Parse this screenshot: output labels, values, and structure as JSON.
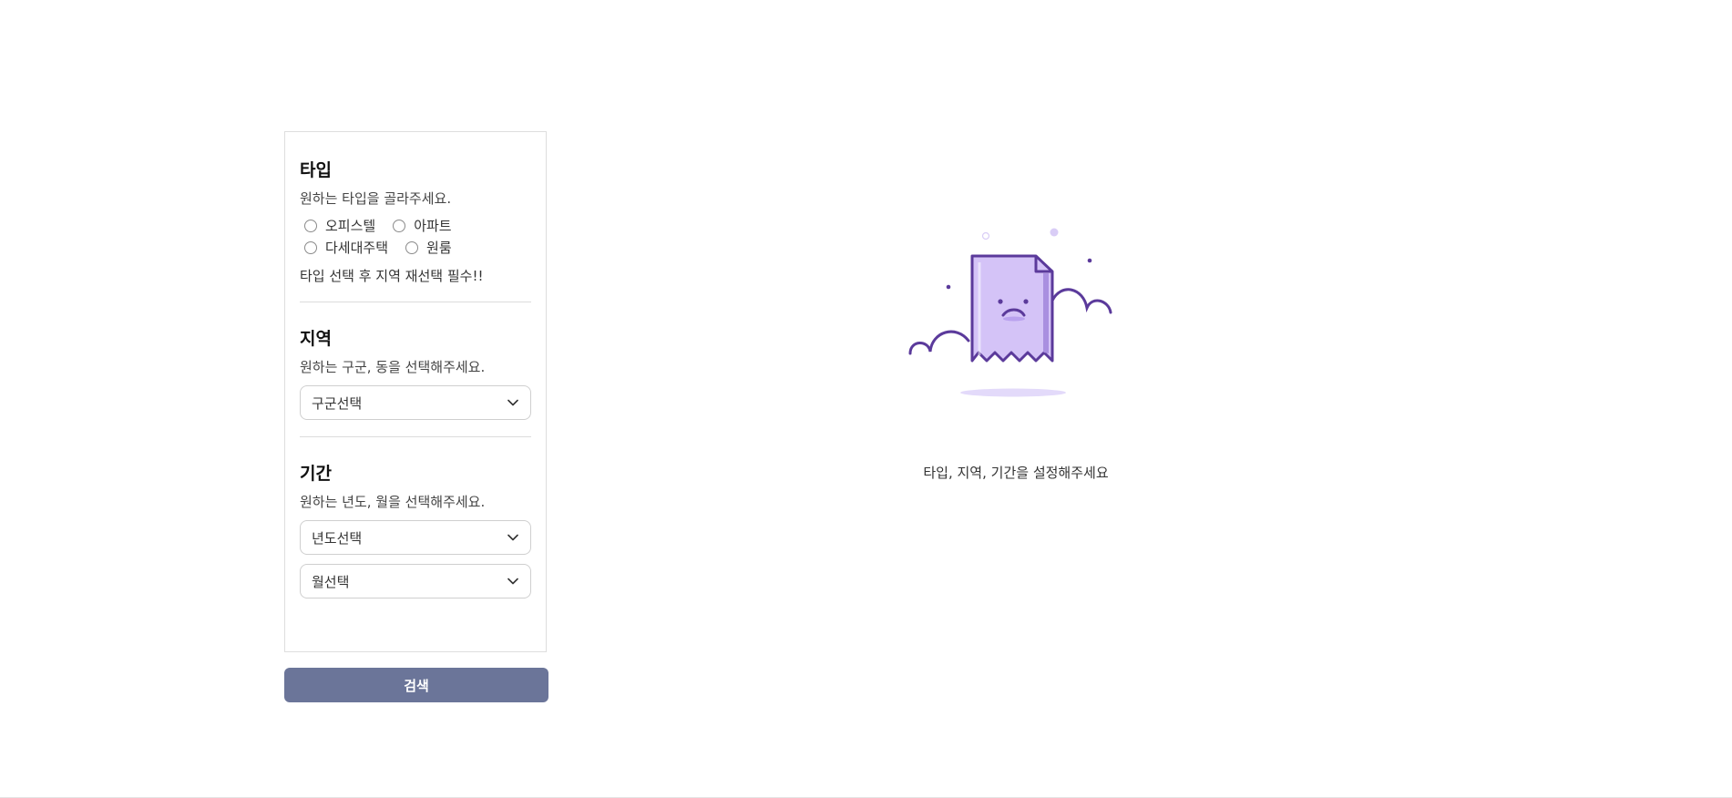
{
  "type_section": {
    "title": "타입",
    "description": "원하는 타입을 골라주세요.",
    "options_row1": [
      "오피스텔",
      "아파트"
    ],
    "options_row2": [
      "다세대주택",
      "원룸"
    ],
    "note": "타입 선택 후 지역 재선택 필수!!"
  },
  "region_section": {
    "title": "지역",
    "description": "원하는 구군, 동을 선택해주세요.",
    "district_select": "구군선택"
  },
  "period_section": {
    "title": "기간",
    "description": "원하는 년도, 월을 선택해주세요.",
    "year_select": "년도선택",
    "month_select": "월선택"
  },
  "search_button_label": "검색",
  "empty_state": {
    "message": "타입, 지역, 기간을 설정해주세요",
    "icon": "sad-document-icon"
  },
  "colors": {
    "accent_purple": "#5b3a9b",
    "doc_fill": "#d4c3f7",
    "button_bg": "#6b7599"
  }
}
